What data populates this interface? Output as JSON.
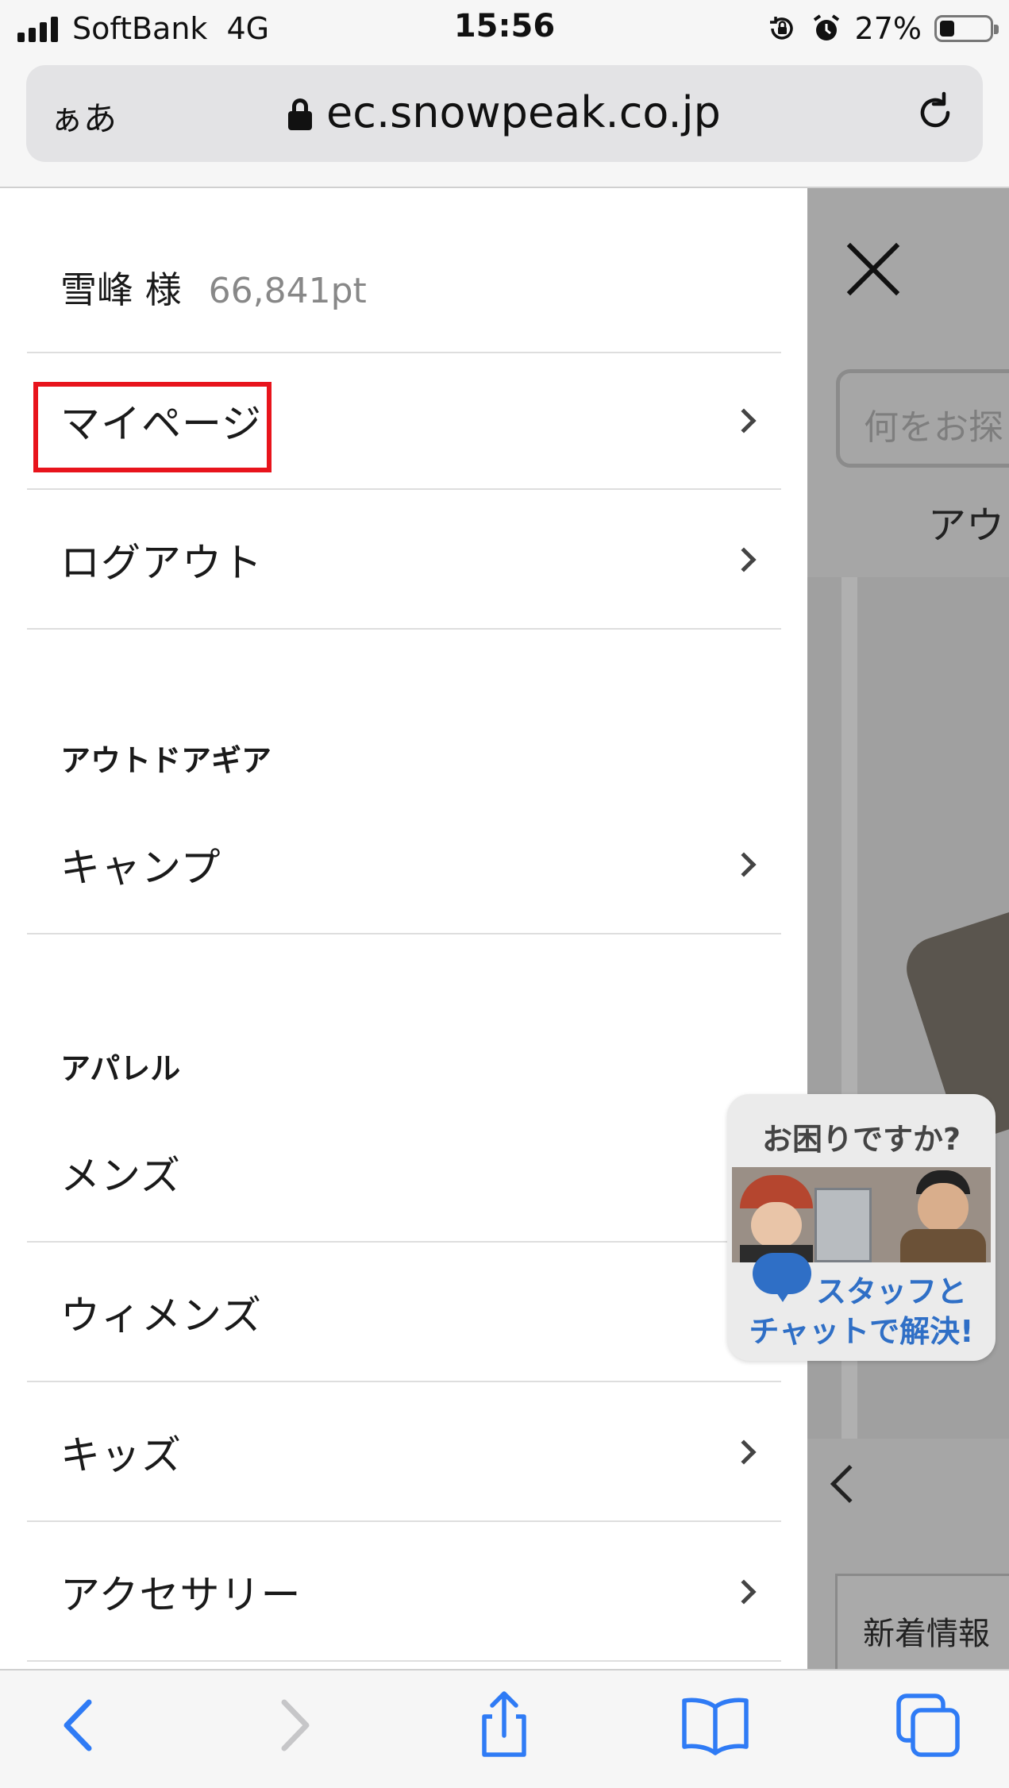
{
  "status_bar": {
    "carrier": "SoftBank",
    "network": "4G",
    "time": "15:56",
    "battery": "27%",
    "icons": [
      "signal-icon",
      "orientation-lock-icon",
      "alarm-icon",
      "battery-icon"
    ]
  },
  "browser": {
    "text_size": "ぁあ",
    "url": "ec.snowpeak.co.jp"
  },
  "menu": {
    "user_name": "雪峰 様",
    "points": "66,841pt",
    "account_items": [
      {
        "label": "マイページ"
      },
      {
        "label": "ログアウト"
      }
    ],
    "section_gear": "アウトドアギア",
    "gear_items": [
      {
        "label": "キャンプ"
      }
    ],
    "section_apparel": "アパレル",
    "apparel_items": [
      {
        "label": "メンズ"
      },
      {
        "label": "ウィメンズ"
      },
      {
        "label": "キッズ"
      },
      {
        "label": "アクセサリー"
      }
    ]
  },
  "background_page": {
    "search_placeholder": "何をお探",
    "nav_text": "アウ",
    "news_tab": "新着情報"
  },
  "chat_widget": {
    "title": "お困りですか?",
    "line1": "スタッフと",
    "line2": "チャットで解決!"
  },
  "colors": {
    "highlight": "#e8141c",
    "toolbar_icon": "#2f7bf5",
    "chat_blue": "#2f6fc6"
  }
}
